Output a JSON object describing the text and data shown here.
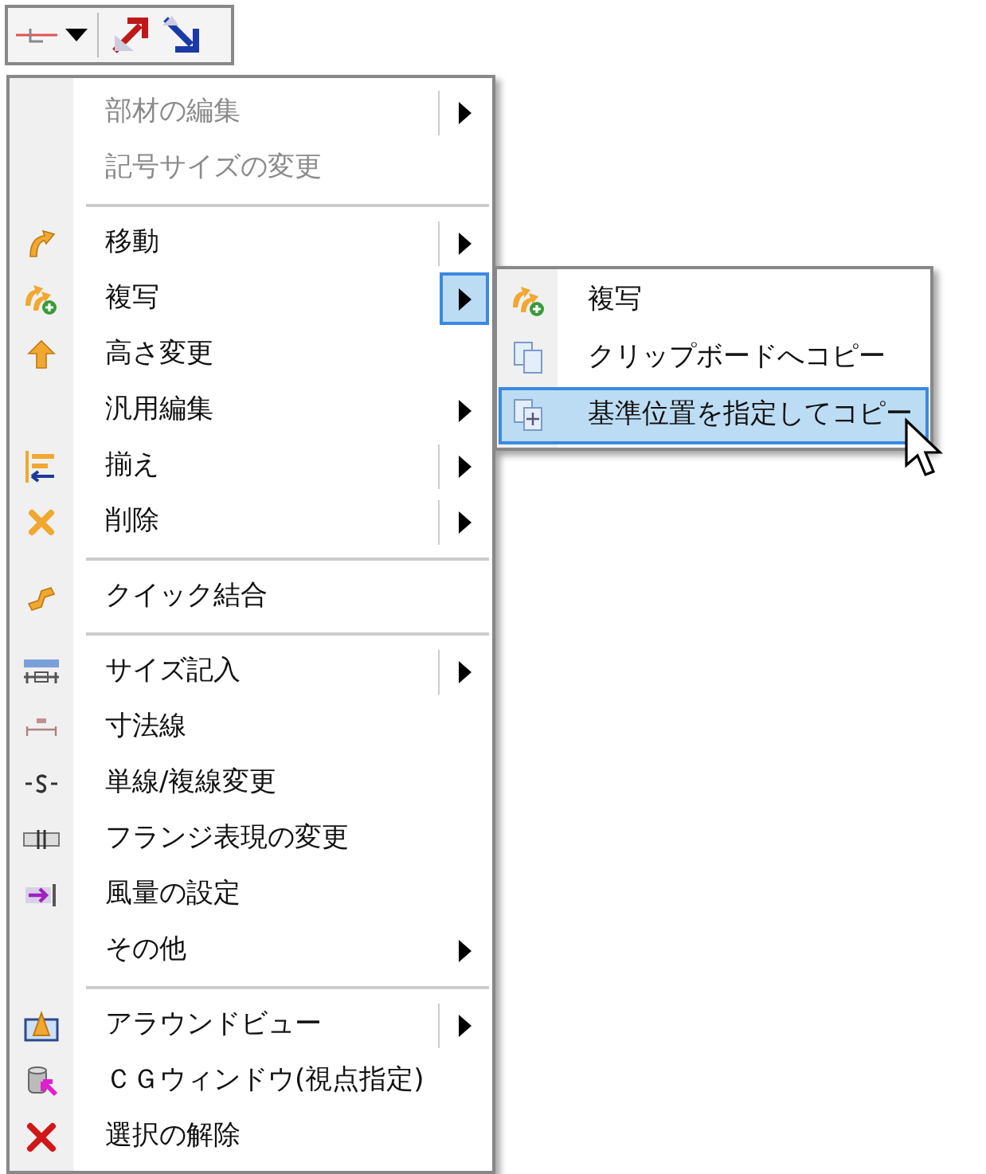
{
  "menu": {
    "items": [
      {
        "kind": "item",
        "label": "部材の編集",
        "disabled": true,
        "submenu": true,
        "split": true,
        "selected": false
      },
      {
        "kind": "item",
        "label": "記号サイズの変更",
        "disabled": true,
        "submenu": false,
        "split": false,
        "selected": false
      },
      {
        "kind": "separator"
      },
      {
        "kind": "item",
        "label": "移動",
        "disabled": false,
        "submenu": true,
        "split": true,
        "selected": false
      },
      {
        "kind": "item",
        "label": "複写",
        "disabled": false,
        "submenu": true,
        "split": false,
        "selected": true
      },
      {
        "kind": "item",
        "label": "高さ変更",
        "disabled": false,
        "submenu": false,
        "split": false,
        "selected": false
      },
      {
        "kind": "item",
        "label": "汎用編集",
        "disabled": false,
        "submenu": true,
        "split": false,
        "selected": false
      },
      {
        "kind": "item",
        "label": "揃え",
        "disabled": false,
        "submenu": true,
        "split": true,
        "selected": false
      },
      {
        "kind": "item",
        "label": "削除",
        "disabled": false,
        "submenu": true,
        "split": true,
        "selected": false
      },
      {
        "kind": "separator"
      },
      {
        "kind": "item",
        "label": "クイック結合",
        "disabled": false,
        "submenu": false,
        "split": false,
        "selected": false
      },
      {
        "kind": "separator"
      },
      {
        "kind": "item",
        "label": "サイズ記入",
        "disabled": false,
        "submenu": true,
        "split": true,
        "selected": false
      },
      {
        "kind": "item",
        "label": "寸法線",
        "disabled": false,
        "submenu": false,
        "split": false,
        "selected": false
      },
      {
        "kind": "item",
        "label": "単線/複線変更",
        "disabled": false,
        "submenu": false,
        "split": false,
        "selected": false
      },
      {
        "kind": "item",
        "label": "フランジ表現の変更",
        "disabled": false,
        "submenu": false,
        "split": false,
        "selected": false
      },
      {
        "kind": "item",
        "label": "風量の設定",
        "disabled": false,
        "submenu": false,
        "split": false,
        "selected": false
      },
      {
        "kind": "item",
        "label": "その他",
        "disabled": false,
        "submenu": true,
        "split": false,
        "selected": false
      },
      {
        "kind": "separator"
      },
      {
        "kind": "item",
        "label": "アラウンドビュー",
        "disabled": false,
        "submenu": true,
        "split": true,
        "selected": false
      },
      {
        "kind": "item",
        "label": "ＣＧウィンドウ(視点指定)",
        "disabled": false,
        "submenu": false,
        "split": false,
        "selected": false
      },
      {
        "kind": "item",
        "label": "選択の解除",
        "disabled": false,
        "submenu": false,
        "split": false,
        "selected": false
      }
    ]
  },
  "submenu": {
    "items": [
      {
        "label": "複写",
        "selected": false
      },
      {
        "label": "クリップボードへコピー",
        "selected": false
      },
      {
        "label": "基準位置を指定してコピー",
        "selected": true
      }
    ]
  }
}
